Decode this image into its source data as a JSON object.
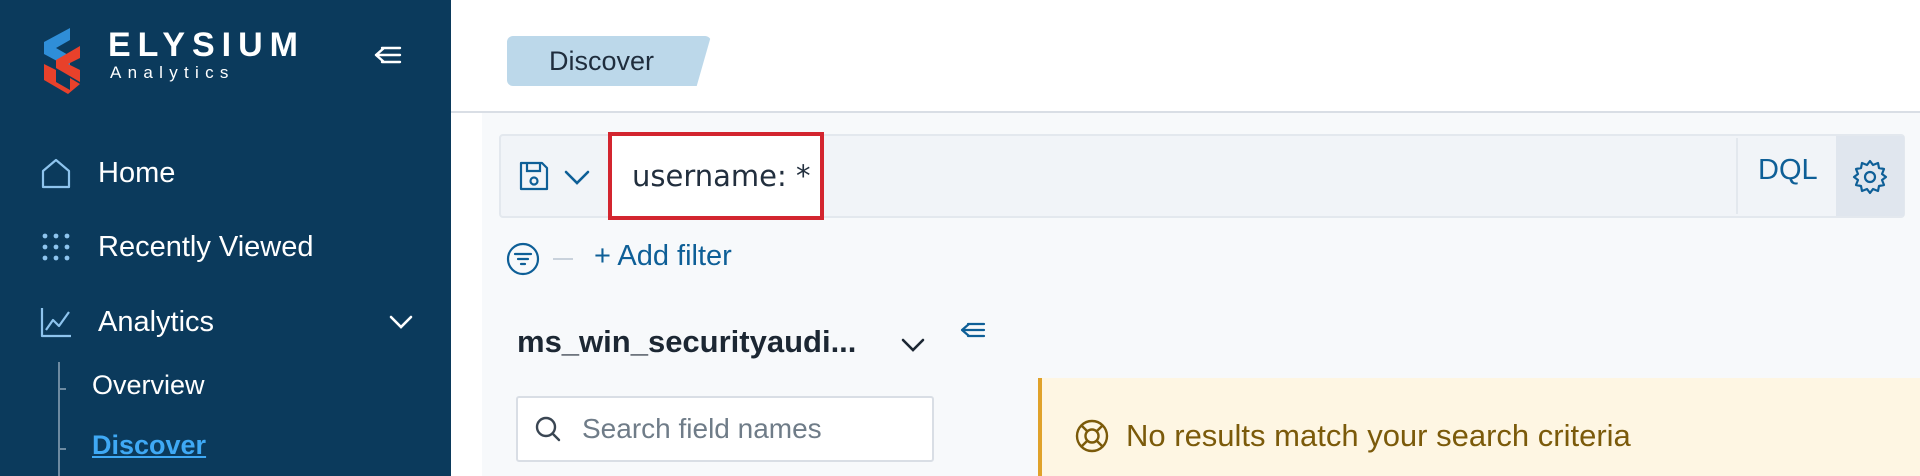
{
  "brand": {
    "name": "ELYSIUM",
    "subtitle": "Analytics"
  },
  "sidebar": {
    "items": [
      {
        "label": "Home",
        "icon": "home-icon"
      },
      {
        "label": "Recently Viewed",
        "icon": "grid-dots-icon"
      },
      {
        "label": "Analytics",
        "icon": "line-chart-icon",
        "expanded": true
      }
    ],
    "analytics_children": [
      {
        "label": "Overview",
        "active": false
      },
      {
        "label": "Discover",
        "active": true
      }
    ]
  },
  "breadcrumb": {
    "current": "Discover"
  },
  "query": {
    "value": "username: *",
    "language_label": "DQL",
    "save_icon": "save-icon",
    "settings_icon": "gear-icon"
  },
  "filters": {
    "add_label": "+ Add filter"
  },
  "index_pattern": {
    "name": "ms_win_securityaudi..."
  },
  "field_search": {
    "placeholder": "Search field names"
  },
  "results": {
    "empty_message": "No results match your search criteria"
  },
  "colors": {
    "sidebar_bg": "#0b3a5c",
    "accent_link": "#0e5f97",
    "active_nav": "#3fa9f5",
    "highlight_border": "#d3252f",
    "warning_bg": "#fef6e3",
    "warning_text": "#7b5a0a"
  }
}
